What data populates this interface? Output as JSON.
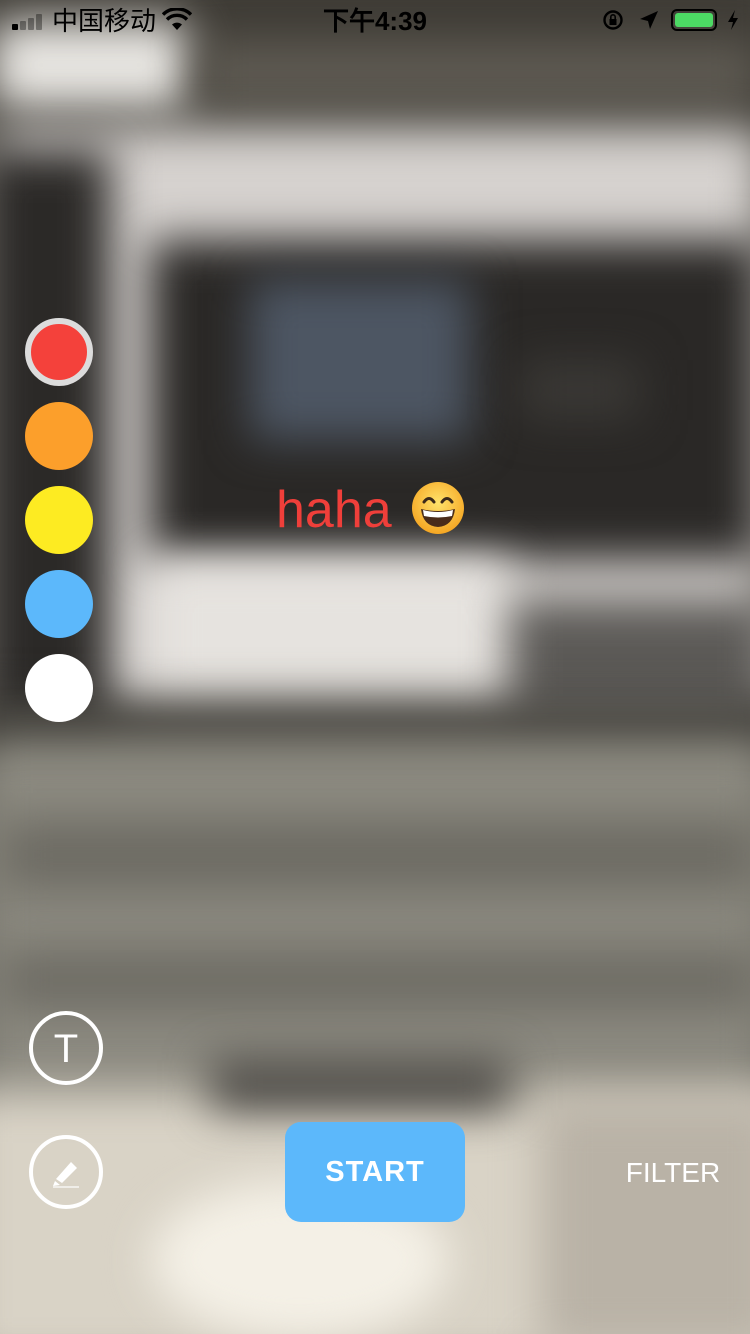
{
  "status_bar": {
    "carrier": "中国移动",
    "time": "下午4:39",
    "battery_color": "#4cd964"
  },
  "palette": {
    "colors": [
      "#f4413b",
      "#fc9f2b",
      "#fdeb22",
      "#5cb8fb",
      "#ffffff"
    ],
    "selected_index": 0
  },
  "overlay": {
    "text": "haha",
    "text_color": "#ef3f3a",
    "emoji": "grinning-face-with-smiling-eyes"
  },
  "controls": {
    "text_tool_label": "T",
    "start_label": "START",
    "start_color": "#5cb8fb",
    "filter_label": "FILTER"
  }
}
